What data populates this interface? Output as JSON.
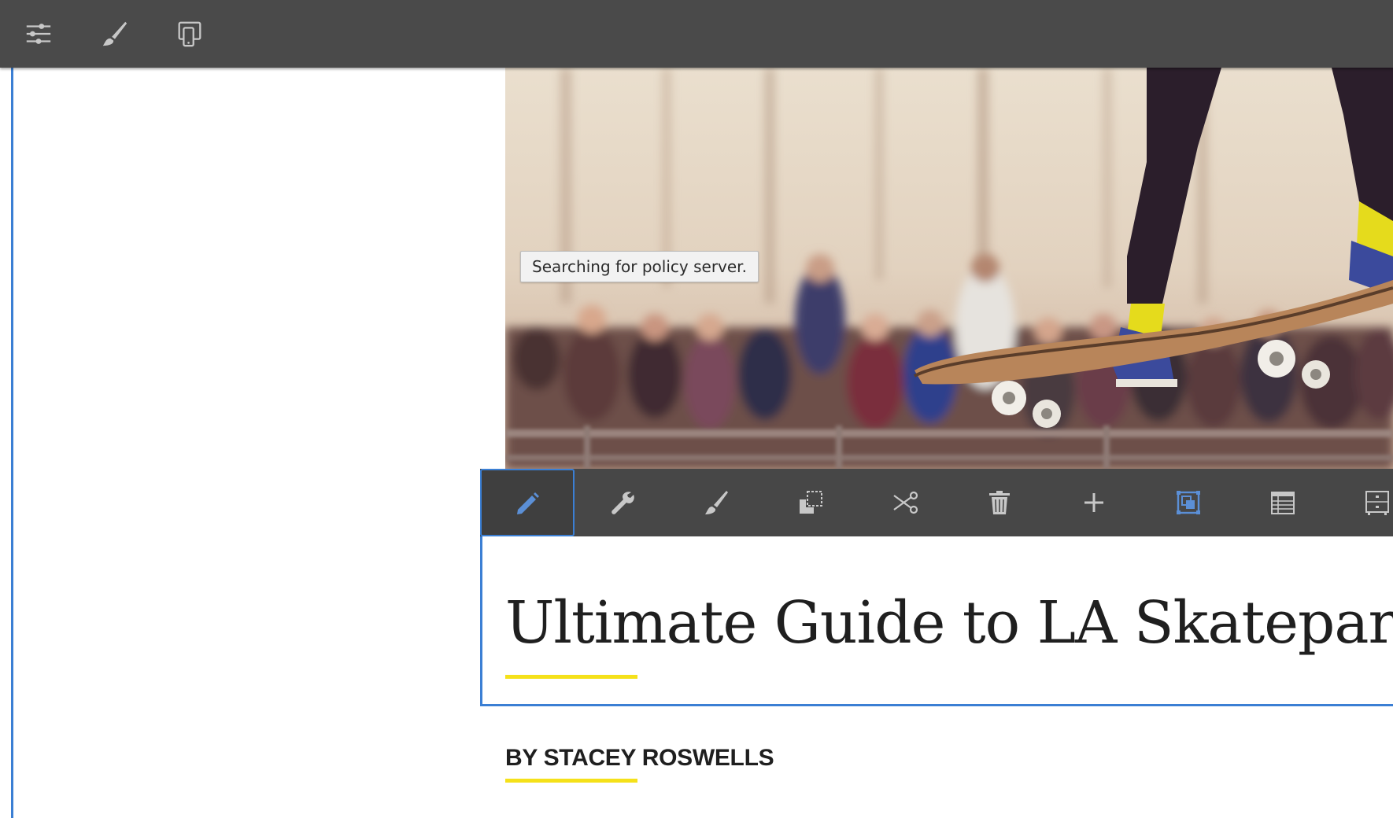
{
  "top_toolbar": {
    "buttons": [
      {
        "name": "properties",
        "icon": "sliders-icon"
      },
      {
        "name": "style",
        "icon": "brush-icon"
      },
      {
        "name": "emulator",
        "icon": "devices-icon"
      }
    ]
  },
  "tooltip": {
    "text": "Searching for policy server."
  },
  "component_toolbar": {
    "buttons": [
      {
        "name": "edit",
        "icon": "pencil-icon",
        "active": true
      },
      {
        "name": "configure",
        "icon": "wrench-icon"
      },
      {
        "name": "style",
        "icon": "brush-icon"
      },
      {
        "name": "copy",
        "icon": "copy-icon"
      },
      {
        "name": "cut",
        "icon": "scissors-icon"
      },
      {
        "name": "delete",
        "icon": "trash-icon"
      },
      {
        "name": "insert",
        "icon": "plus-icon"
      },
      {
        "name": "select-parent",
        "icon": "group-icon"
      },
      {
        "name": "layout",
        "icon": "table-icon"
      },
      {
        "name": "more",
        "icon": "cabinet-icon"
      }
    ]
  },
  "article": {
    "title": "Ultimate Guide to LA Skateparks",
    "byline": "BY STACEY ROSWELLS"
  },
  "colors": {
    "toolbar_bg": "#4a4a4a",
    "selection_blue": "#3b7fd4",
    "accent_yellow": "#f5e11a",
    "icon_gray": "#c8c8c8"
  }
}
